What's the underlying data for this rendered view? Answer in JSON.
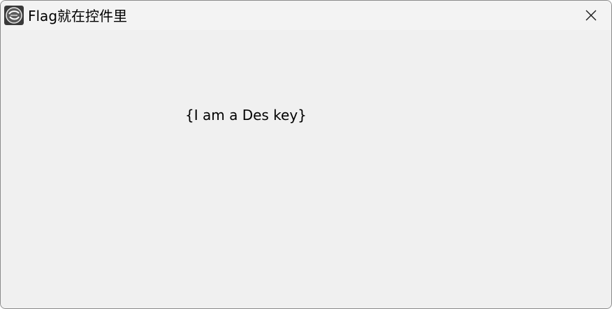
{
  "window": {
    "title": "Flag就在控件里",
    "icon": "app-logo-icon",
    "close_icon": "close-icon"
  },
  "content": {
    "label_text": "{I am a Des key}"
  }
}
